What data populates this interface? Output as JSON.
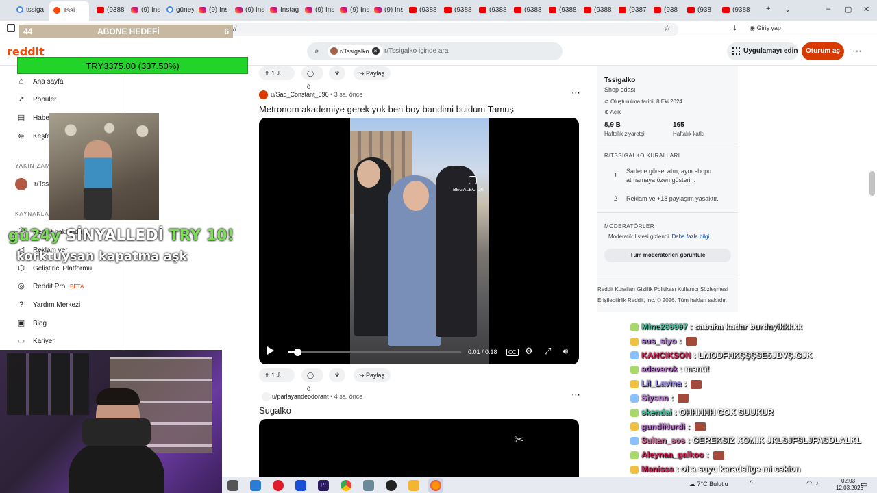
{
  "browser": {
    "tabs": [
      {
        "label": "tssiga",
        "icon": "google-icon"
      },
      {
        "label": "Tssi",
        "icon": "reddit-icon",
        "active": true
      },
      {
        "label": "(9388",
        "icon": "youtube-icon"
      },
      {
        "label": "(9) Ins",
        "icon": "instagram-icon"
      },
      {
        "label": "güney",
        "icon": "google-icon"
      },
      {
        "label": "(9) Ins",
        "icon": "instagram-icon"
      },
      {
        "label": "(9) Ins",
        "icon": "instagram-icon"
      },
      {
        "label": "Instag",
        "icon": "instagram-icon"
      },
      {
        "label": "(9) Ins",
        "icon": "instagram-icon"
      },
      {
        "label": "(9) Ins",
        "icon": "instagram-icon"
      },
      {
        "label": "(9) Ins",
        "icon": "instagram-icon"
      },
      {
        "label": "(9388",
        "icon": "youtube-icon"
      },
      {
        "label": "(9388",
        "icon": "youtube-icon"
      },
      {
        "label": "(9388",
        "icon": "youtube-icon"
      },
      {
        "label": "(9388",
        "icon": "youtube-icon"
      },
      {
        "label": "(9388",
        "icon": "youtube-icon"
      },
      {
        "label": "(9388",
        "icon": "youtube-icon"
      },
      {
        "label": "(9387",
        "icon": "youtube-icon"
      },
      {
        "label": "(938",
        "icon": "youtube-icon"
      },
      {
        "label": "(938",
        "icon": "youtube-icon"
      },
      {
        "label": "(9388",
        "icon": "youtube-icon"
      }
    ],
    "url_fragment": "ew/",
    "signin_label": "Giriş yap"
  },
  "reddit": {
    "logo": "reddit",
    "search_chip": "r/Tssigalko",
    "search_placeholder": "r/Tssigalko içinde ara",
    "get_app": "Uygulamayı edin",
    "login": "Oturum aç"
  },
  "sidebar": {
    "items": [
      {
        "label": "Ana sayfa",
        "icon": "home-icon"
      },
      {
        "label": "Popüler",
        "icon": "popular-icon"
      },
      {
        "label": "Haber",
        "icon": "news-icon"
      },
      {
        "label": "Keşfet",
        "icon": "explore-icon"
      }
    ],
    "recent_head": "YAKIN ZAM",
    "recent_item": "r/Tssig",
    "resources_head": "KAYNAKLAR",
    "resources": [
      {
        "label": "Reddit hakkında",
        "icon": "info-icon"
      },
      {
        "label": "Reklam ver",
        "icon": "megaphone-icon"
      },
      {
        "label": "Geliştirici Platformu",
        "icon": "dev-icon"
      },
      {
        "label": "Reddit Pro",
        "icon": "pro-icon",
        "badge": "BETA"
      },
      {
        "label": "Yardım Merkezi",
        "icon": "help-icon"
      },
      {
        "label": "Blog",
        "icon": "blog-icon"
      },
      {
        "label": "Kariyer",
        "icon": "career-icon"
      }
    ]
  },
  "posts": [
    {
      "votes": "1",
      "comments": "0",
      "share": "Paylaş",
      "author": "u/Sad_Constant_596",
      "time": "3 sa. önce",
      "title": "Metronom akademiye gerek yok ben boy bandimi buldum Tamuş",
      "video_time": "0:01 / 0:18",
      "video_progress": 0.055,
      "watermark": "BEGALEC_26"
    },
    {
      "votes": "1",
      "comments": "0",
      "share": "Paylaş",
      "author": "u/parlayandeodorant",
      "time": "4 sa. önce",
      "title": "Sugalko"
    }
  ],
  "rail": {
    "name": "Tssigalko",
    "desc": "Shop odası",
    "created": "Oluşturulma tarihi: 8 Eki 2024",
    "visibility": "Açık",
    "stat1_value": "8,9 B",
    "stat1_label": "Haftalık ziyaretçi",
    "stat2_value": "165",
    "stat2_label": "Haftalık katkı",
    "rules_head": "R/TSSİGALKO KURALLARI",
    "rules": [
      {
        "num": "1",
        "text": "Sadece görsel atın, aynı shopu atmamaya özen gösterin."
      },
      {
        "num": "2",
        "text": "Reklam ve +18 paylaşım yasaktır."
      }
    ],
    "mods_head": "MODERATÖRLER",
    "mods_hidden": "Moderatör listesi gizlendi.",
    "mods_more": "Daha fazla bilgi",
    "mods_button": "Tüm moderatörleri görüntüle",
    "footer1": "Reddit Kuralları   Gizlilik Politikası   Kullanıcı Sözleşmesi",
    "footer2": "Erişilebilirlik   Reddit, Inc. © 2026. Tüm hakları saklıdır."
  },
  "overlay": {
    "sub_goal_left": "44",
    "sub_goal_title": "ABONE HEDEFİ",
    "sub_goal_right": "6",
    "donation_bar": "TRY3375.00 (337.50%)",
    "alert_user": "gü24y",
    "alert_middle": " SİNYALLEDİ ",
    "alert_amount": "TRY 10!",
    "alert_message": "korktuysan kapatma aşk"
  },
  "chat": [
    {
      "user": "Mine269997",
      "color": "#3cc7a0",
      "text": "sabaha kadar burdayikkkkk"
    },
    {
      "user": "sus_siyo",
      "color": "#b57be0",
      "text": "",
      "emote": true
    },
    {
      "user": "KANCIKSON",
      "color": "#e0245e",
      "text": "LMODFHKŞŞŞSE5JBVŞ.GJK"
    },
    {
      "user": "adavarok",
      "color": "#c678dd",
      "text": "menü!"
    },
    {
      "user": "Lil_Lavina",
      "color": "#9b87f5",
      "text": "",
      "emote": true
    },
    {
      "user": "Siyenn",
      "color": "#c678dd",
      "text": "",
      "emote": true
    },
    {
      "user": "skendai",
      "color": "#3cc7a0",
      "text": "OHHHHH COK SUUKUR"
    },
    {
      "user": "gundiNurdi",
      "color": "#c678dd",
      "text": "",
      "emote": true
    },
    {
      "user": "Sultan_sos",
      "color": "#d96aa0",
      "text": "GEREKSIZ KOMIK JKLSJFSLJFASDLALKL"
    },
    {
      "user": "Aleynaa_galkoo",
      "color": "#e0245e",
      "text": "",
      "emote": true
    },
    {
      "user": "Manissa",
      "color": "#e0245e",
      "text": "oha suyu karadelige mi cekion"
    }
  ],
  "taskbar": {
    "weather": "7°C  Bulutlu",
    "time": "02:03",
    "date": "12.03.2026"
  }
}
